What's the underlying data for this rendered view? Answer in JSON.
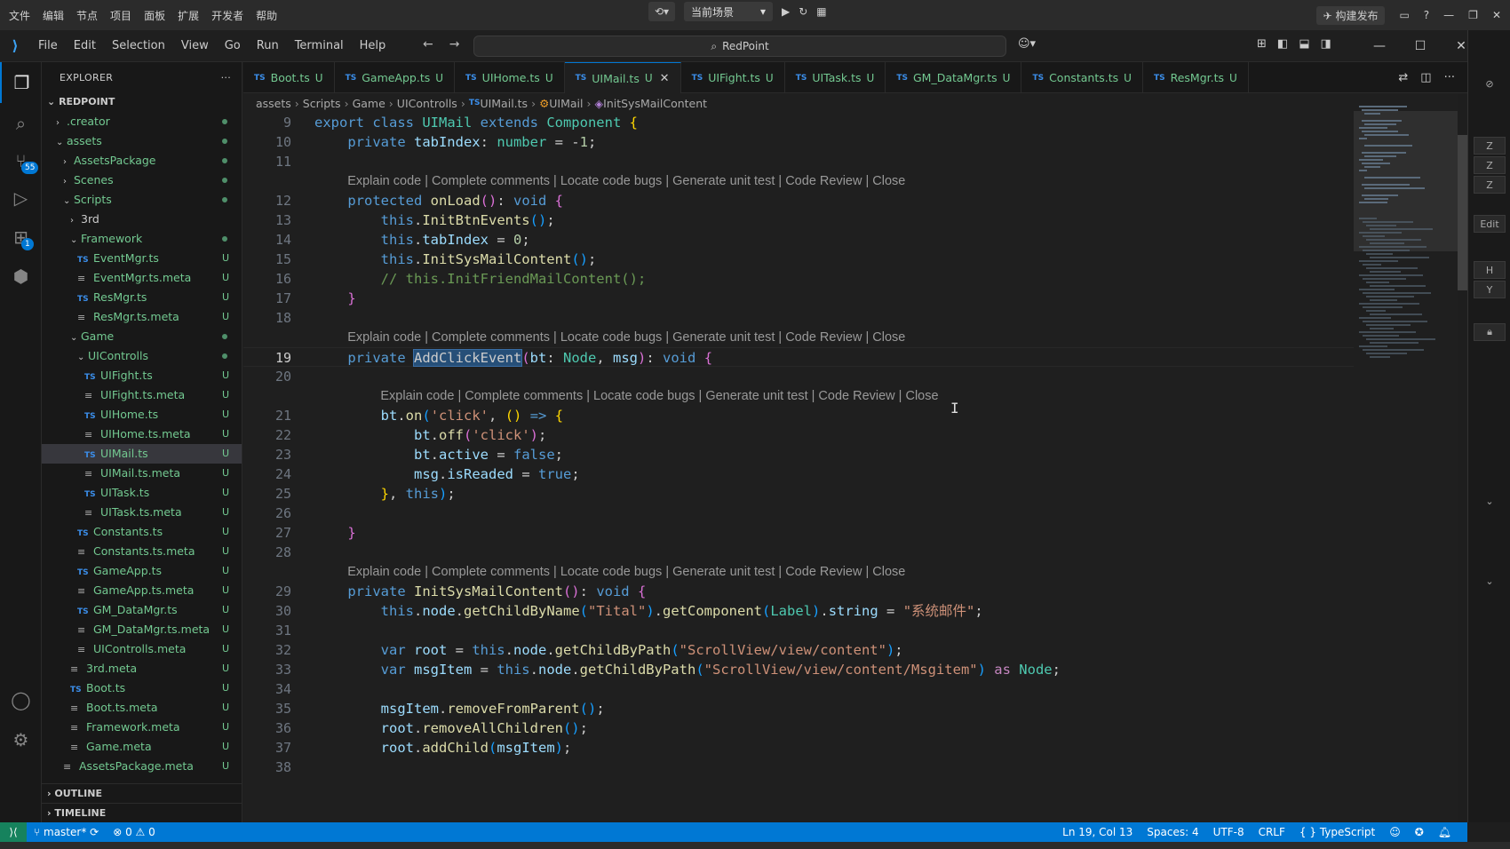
{
  "host": {
    "menu": [
      "文件",
      "编辑",
      "节点",
      "项目",
      "面板",
      "扩展",
      "开发者",
      "帮助"
    ],
    "scene": "当前场景",
    "publish": "构建发布"
  },
  "window": {
    "menu": [
      "File",
      "Edit",
      "Selection",
      "View",
      "Go",
      "Run",
      "Terminal",
      "Help"
    ],
    "search": "RedPoint"
  },
  "activity": {
    "scm_badge": "55",
    "extensions_badge": "1"
  },
  "explorer": {
    "title": "EXPLORER",
    "more": "···",
    "root": "REDPOINT",
    "tree": [
      {
        "label": ".creator",
        "type": "folder",
        "open": false,
        "depth": 1,
        "status": "dot"
      },
      {
        "label": "assets",
        "type": "folder",
        "open": true,
        "depth": 1,
        "status": "dot"
      },
      {
        "label": "AssetsPackage",
        "type": "folder",
        "open": false,
        "depth": 2,
        "status": "dot"
      },
      {
        "label": "Scenes",
        "type": "folder",
        "open": false,
        "depth": 2,
        "status": "dot"
      },
      {
        "label": "Scripts",
        "type": "folder",
        "open": true,
        "depth": 2,
        "status": "dot"
      },
      {
        "label": "3rd",
        "type": "folder",
        "open": false,
        "depth": 3,
        "status": "",
        "plain": true
      },
      {
        "label": "Framework",
        "type": "folder",
        "open": true,
        "depth": 3,
        "status": "dot"
      },
      {
        "label": "EventMgr.ts",
        "type": "ts",
        "depth": 4,
        "status": "U"
      },
      {
        "label": "EventMgr.ts.meta",
        "type": "meta",
        "depth": 4,
        "status": "U"
      },
      {
        "label": "ResMgr.ts",
        "type": "ts",
        "depth": 4,
        "status": "U"
      },
      {
        "label": "ResMgr.ts.meta",
        "type": "meta",
        "depth": 4,
        "status": "U"
      },
      {
        "label": "Game",
        "type": "folder",
        "open": true,
        "depth": 3,
        "status": "dot"
      },
      {
        "label": "UIControlls",
        "type": "folder",
        "open": true,
        "depth": 4,
        "status": "dot"
      },
      {
        "label": "UIFight.ts",
        "type": "ts",
        "depth": 5,
        "status": "U"
      },
      {
        "label": "UIFight.ts.meta",
        "type": "meta",
        "depth": 5,
        "status": "U"
      },
      {
        "label": "UIHome.ts",
        "type": "ts",
        "depth": 5,
        "status": "U"
      },
      {
        "label": "UIHome.ts.meta",
        "type": "meta",
        "depth": 5,
        "status": "U"
      },
      {
        "label": "UIMail.ts",
        "type": "ts",
        "depth": 5,
        "status": "U",
        "selected": true
      },
      {
        "label": "UIMail.ts.meta",
        "type": "meta",
        "depth": 5,
        "status": "U"
      },
      {
        "label": "UITask.ts",
        "type": "ts",
        "depth": 5,
        "status": "U"
      },
      {
        "label": "UITask.ts.meta",
        "type": "meta",
        "depth": 5,
        "status": "U"
      },
      {
        "label": "Constants.ts",
        "type": "ts",
        "depth": 4,
        "status": "U"
      },
      {
        "label": "Constants.ts.meta",
        "type": "meta",
        "depth": 4,
        "status": "U"
      },
      {
        "label": "GameApp.ts",
        "type": "ts",
        "depth": 4,
        "status": "U"
      },
      {
        "label": "GameApp.ts.meta",
        "type": "meta",
        "depth": 4,
        "status": "U"
      },
      {
        "label": "GM_DataMgr.ts",
        "type": "ts",
        "depth": 4,
        "status": "U"
      },
      {
        "label": "GM_DataMgr.ts.meta",
        "type": "meta",
        "depth": 4,
        "status": "U"
      },
      {
        "label": "UIControlls.meta",
        "type": "meta",
        "depth": 4,
        "status": "U"
      },
      {
        "label": "3rd.meta",
        "type": "meta",
        "depth": 3,
        "status": "U"
      },
      {
        "label": "Boot.ts",
        "type": "ts",
        "depth": 3,
        "status": "U"
      },
      {
        "label": "Boot.ts.meta",
        "type": "meta",
        "depth": 3,
        "status": "U"
      },
      {
        "label": "Framework.meta",
        "type": "meta",
        "depth": 3,
        "status": "U"
      },
      {
        "label": "Game.meta",
        "type": "meta",
        "depth": 3,
        "status": "U"
      },
      {
        "label": "AssetsPackage.meta",
        "type": "meta",
        "depth": 2,
        "status": "U"
      }
    ],
    "outline": "OUTLINE",
    "timeline": "TIMELINE"
  },
  "tabs": [
    {
      "label": "Boot.ts",
      "status": "U"
    },
    {
      "label": "GameApp.ts",
      "status": "U"
    },
    {
      "label": "UIHome.ts",
      "status": "U"
    },
    {
      "label": "UIMail.ts",
      "status": "U",
      "active": true
    },
    {
      "label": "UIFight.ts",
      "status": "U"
    },
    {
      "label": "UITask.ts",
      "status": "U"
    },
    {
      "label": "GM_DataMgr.ts",
      "status": "U"
    },
    {
      "label": "Constants.ts",
      "status": "U"
    },
    {
      "label": "ResMgr.ts",
      "status": "U"
    }
  ],
  "breadcrumbs": [
    "assets",
    "Scripts",
    "Game",
    "UIControlls",
    "UIMail.ts",
    "UIMail",
    "InitSysMailContent"
  ],
  "code_lens": "Explain code | Complete comments | Locate code bugs | Generate unit test | Code Review | Close",
  "code": [
    {
      "ln": "9",
      "tokens": [
        [
          "kw",
          "export "
        ],
        [
          "kw",
          "class "
        ],
        [
          "cls",
          "UIMail "
        ],
        [
          "kw",
          "extends "
        ],
        [
          "cls",
          "Component "
        ],
        [
          "br1",
          "{"
        ]
      ]
    },
    {
      "ln": "10",
      "tokens": [
        [
          "t",
          "    "
        ],
        [
          "kw",
          "private "
        ],
        [
          "prop",
          "tabIndex"
        ],
        [
          "t",
          ": "
        ],
        [
          "cls",
          "number"
        ],
        [
          "t",
          " = -"
        ],
        [
          "num",
          "1"
        ],
        [
          "t",
          ";"
        ]
      ]
    },
    {
      "ln": "11",
      "tokens": []
    },
    {
      "lens": true,
      "indent": 4
    },
    {
      "ln": "12",
      "tokens": [
        [
          "t",
          "    "
        ],
        [
          "kw",
          "protected "
        ],
        [
          "fn",
          "onLoad"
        ],
        [
          "br2",
          "()"
        ],
        [
          "t",
          ": "
        ],
        [
          "kw",
          "void "
        ],
        [
          "br2",
          "{"
        ]
      ]
    },
    {
      "ln": "13",
      "tokens": [
        [
          "t",
          "        "
        ],
        [
          "kw",
          "this"
        ],
        [
          "t",
          "."
        ],
        [
          "fn",
          "InitBtnEvents"
        ],
        [
          "br3",
          "()"
        ],
        [
          "t",
          ";"
        ]
      ]
    },
    {
      "ln": "14",
      "tokens": [
        [
          "t",
          "        "
        ],
        [
          "kw",
          "this"
        ],
        [
          "t",
          "."
        ],
        [
          "prop",
          "tabIndex"
        ],
        [
          "t",
          " = "
        ],
        [
          "num",
          "0"
        ],
        [
          "t",
          ";"
        ]
      ]
    },
    {
      "ln": "15",
      "tokens": [
        [
          "t",
          "        "
        ],
        [
          "kw",
          "this"
        ],
        [
          "t",
          "."
        ],
        [
          "fn",
          "InitSysMailContent"
        ],
        [
          "br3",
          "()"
        ],
        [
          "t",
          ";"
        ]
      ]
    },
    {
      "ln": "16",
      "tokens": [
        [
          "t",
          "        "
        ],
        [
          "cmt",
          "// this.InitFriendMailContent();"
        ]
      ]
    },
    {
      "ln": "17",
      "tokens": [
        [
          "t",
          "    "
        ],
        [
          "br2",
          "}"
        ]
      ]
    },
    {
      "ln": "18",
      "tokens": []
    },
    {
      "lens": true,
      "indent": 4
    },
    {
      "ln": "19",
      "current": true,
      "tokens": [
        [
          "t",
          "    "
        ],
        [
          "kw",
          "private "
        ],
        [
          "hl",
          "AddClickEvent"
        ],
        [
          "br2",
          "("
        ],
        [
          "prop",
          "bt"
        ],
        [
          "t",
          ": "
        ],
        [
          "cls",
          "Node"
        ],
        [
          "t",
          ", "
        ],
        [
          "prop",
          "msg"
        ],
        [
          "br2",
          ")"
        ],
        [
          "t",
          ": "
        ],
        [
          "kw",
          "void "
        ],
        [
          "br2",
          "{"
        ]
      ]
    },
    {
      "ln": "20",
      "tokens": []
    },
    {
      "lens": true,
      "indent": 8
    },
    {
      "ln": "21",
      "tokens": [
        [
          "t",
          "        "
        ],
        [
          "prop",
          "bt"
        ],
        [
          "t",
          "."
        ],
        [
          "fn",
          "on"
        ],
        [
          "br3",
          "("
        ],
        [
          "str",
          "'click'"
        ],
        [
          "t",
          ", "
        ],
        [
          "br1",
          "()"
        ],
        [
          "t",
          " "
        ],
        [
          "kw",
          "=>"
        ],
        [
          "t",
          " "
        ],
        [
          "br1",
          "{"
        ]
      ]
    },
    {
      "ln": "22",
      "tokens": [
        [
          "t",
          "            "
        ],
        [
          "prop",
          "bt"
        ],
        [
          "t",
          "."
        ],
        [
          "fn",
          "off"
        ],
        [
          "br2",
          "("
        ],
        [
          "str",
          "'click'"
        ],
        [
          "br2",
          ")"
        ],
        [
          "t",
          ";"
        ]
      ]
    },
    {
      "ln": "23",
      "tokens": [
        [
          "t",
          "            "
        ],
        [
          "prop",
          "bt"
        ],
        [
          "t",
          "."
        ],
        [
          "prop",
          "active"
        ],
        [
          "t",
          " = "
        ],
        [
          "kw",
          "false"
        ],
        [
          "t",
          ";"
        ]
      ]
    },
    {
      "ln": "24",
      "tokens": [
        [
          "t",
          "            "
        ],
        [
          "prop",
          "msg"
        ],
        [
          "t",
          "."
        ],
        [
          "prop",
          "isReaded"
        ],
        [
          "t",
          " = "
        ],
        [
          "kw",
          "true"
        ],
        [
          "t",
          ";"
        ]
      ]
    },
    {
      "ln": "25",
      "tokens": [
        [
          "t",
          "        "
        ],
        [
          "br1",
          "}"
        ],
        [
          "t",
          ", "
        ],
        [
          "kw",
          "this"
        ],
        [
          "br3",
          ")"
        ],
        [
          "t",
          ";"
        ]
      ]
    },
    {
      "ln": "26",
      "tokens": []
    },
    {
      "ln": "27",
      "tokens": [
        [
          "t",
          "    "
        ],
        [
          "br2",
          "}"
        ]
      ]
    },
    {
      "ln": "28",
      "tokens": []
    },
    {
      "lens": true,
      "indent": 4
    },
    {
      "ln": "29",
      "tokens": [
        [
          "t",
          "    "
        ],
        [
          "kw",
          "private "
        ],
        [
          "fn",
          "InitSysMailContent"
        ],
        [
          "br2",
          "()"
        ],
        [
          "t",
          ": "
        ],
        [
          "kw",
          "void "
        ],
        [
          "br2",
          "{"
        ]
      ]
    },
    {
      "ln": "30",
      "tokens": [
        [
          "t",
          "        "
        ],
        [
          "kw",
          "this"
        ],
        [
          "t",
          "."
        ],
        [
          "prop",
          "node"
        ],
        [
          "t",
          "."
        ],
        [
          "fn",
          "getChildByName"
        ],
        [
          "br3",
          "("
        ],
        [
          "str",
          "\"Tital\""
        ],
        [
          "br3",
          ")"
        ],
        [
          "t",
          "."
        ],
        [
          "fn",
          "getComponent"
        ],
        [
          "br3",
          "("
        ],
        [
          "cls",
          "Label"
        ],
        [
          "br3",
          ")"
        ],
        [
          "t",
          "."
        ],
        [
          "prop",
          "string"
        ],
        [
          "t",
          " = "
        ],
        [
          "str",
          "\"系统邮件\""
        ],
        [
          "t",
          ";"
        ]
      ]
    },
    {
      "ln": "31",
      "tokens": []
    },
    {
      "ln": "32",
      "tokens": [
        [
          "t",
          "        "
        ],
        [
          "kw",
          "var "
        ],
        [
          "prop",
          "root"
        ],
        [
          "t",
          " = "
        ],
        [
          "kw",
          "this"
        ],
        [
          "t",
          "."
        ],
        [
          "prop",
          "node"
        ],
        [
          "t",
          "."
        ],
        [
          "fn",
          "getChildByPath"
        ],
        [
          "br3",
          "("
        ],
        [
          "str",
          "\"ScrollView/view/content\""
        ],
        [
          "br3",
          ")"
        ],
        [
          "t",
          ";"
        ]
      ]
    },
    {
      "ln": "33",
      "tokens": [
        [
          "t",
          "        "
        ],
        [
          "kw",
          "var "
        ],
        [
          "prop",
          "msgItem"
        ],
        [
          "t",
          " = "
        ],
        [
          "kw",
          "this"
        ],
        [
          "t",
          "."
        ],
        [
          "prop",
          "node"
        ],
        [
          "t",
          "."
        ],
        [
          "fn",
          "getChildByPath"
        ],
        [
          "br3",
          "("
        ],
        [
          "str",
          "\"ScrollView/view/content/Msgitem\""
        ],
        [
          "br3",
          ")"
        ],
        [
          "t",
          " "
        ],
        [
          "kw2",
          "as "
        ],
        [
          "cls",
          "Node"
        ],
        [
          "t",
          ";"
        ]
      ]
    },
    {
      "ln": "34",
      "tokens": []
    },
    {
      "ln": "35",
      "tokens": [
        [
          "t",
          "        "
        ],
        [
          "prop",
          "msgItem"
        ],
        [
          "t",
          "."
        ],
        [
          "fn",
          "removeFromParent"
        ],
        [
          "br3",
          "()"
        ],
        [
          "t",
          ";"
        ]
      ]
    },
    {
      "ln": "36",
      "tokens": [
        [
          "t",
          "        "
        ],
        [
          "prop",
          "root"
        ],
        [
          "t",
          "."
        ],
        [
          "fn",
          "removeAllChildren"
        ],
        [
          "br3",
          "()"
        ],
        [
          "t",
          ";"
        ]
      ]
    },
    {
      "ln": "37",
      "tokens": [
        [
          "t",
          "        "
        ],
        [
          "prop",
          "root"
        ],
        [
          "t",
          "."
        ],
        [
          "fn",
          "addChild"
        ],
        [
          "br3",
          "("
        ],
        [
          "prop",
          "msgItem"
        ],
        [
          "br3",
          ")"
        ],
        [
          "t",
          ";"
        ]
      ]
    },
    {
      "ln": "38",
      "tokens": []
    }
  ],
  "right_panel": {
    "edit_label": "Edit",
    "letters": [
      "Z",
      "Z",
      "Z",
      "H",
      "Y"
    ]
  },
  "statusbar": {
    "branch": "master*",
    "errors": "0",
    "warnings": "0",
    "position": "Ln 19, Col 13",
    "spaces": "Spaces: 4",
    "encoding": "UTF-8",
    "eol": "CRLF",
    "language": "TypeScript"
  },
  "colors": {
    "accent": "#0078d4",
    "untracked": "#73c991"
  }
}
